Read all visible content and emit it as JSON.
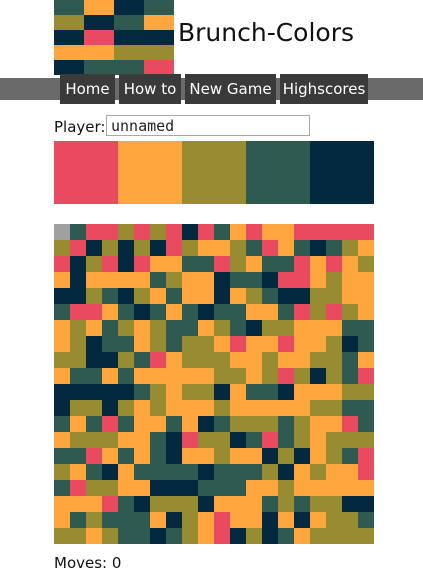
{
  "app": {
    "title": "Brunch-Colors"
  },
  "nav": {
    "items": [
      {
        "label": "Home"
      },
      {
        "label": "How to"
      },
      {
        "label": "New Game"
      },
      {
        "label": "Highscores"
      }
    ]
  },
  "player": {
    "label": "Player:",
    "value": "unnamed"
  },
  "palette": [
    {
      "name": "pink",
      "color": "#E84A5F"
    },
    {
      "name": "orange",
      "color": "#FFA63F"
    },
    {
      "name": "olive",
      "color": "#998B2F"
    },
    {
      "name": "teal",
      "color": "#2E5A4F"
    },
    {
      "name": "navy",
      "color": "#03293E"
    }
  ],
  "logo": {
    "rows": [
      "3143",
      "2431",
      "4044",
      "1122",
      "4330"
    ]
  },
  "board": {
    "selected_cell_color": "#A0A0A0",
    "rows": [
      "0300202040310110000000",
      "2042424021123013432102",
      "0420401133021330101212",
      "1411113211433400121132",
      "4423421311412344221131",
      "3001343134331130202111",
      "1213212331234221113331",
      "1243312322101101124344",
      "2244230122211211223132",
      "1331311111221202423001",
      "4444432122413341112232",
      "4224212111211111223321",
      "3130311314322232110332",
      "1222113402243032122221",
      "3301313411211424123021",
      "2134133334333241211011",
      "3022114443331121111131",
      "1110342224111323224423",
      "1323331421011414122311",
      "2212334321042431222232"
    ]
  },
  "status": {
    "moves_text": "Moves: 0"
  }
}
